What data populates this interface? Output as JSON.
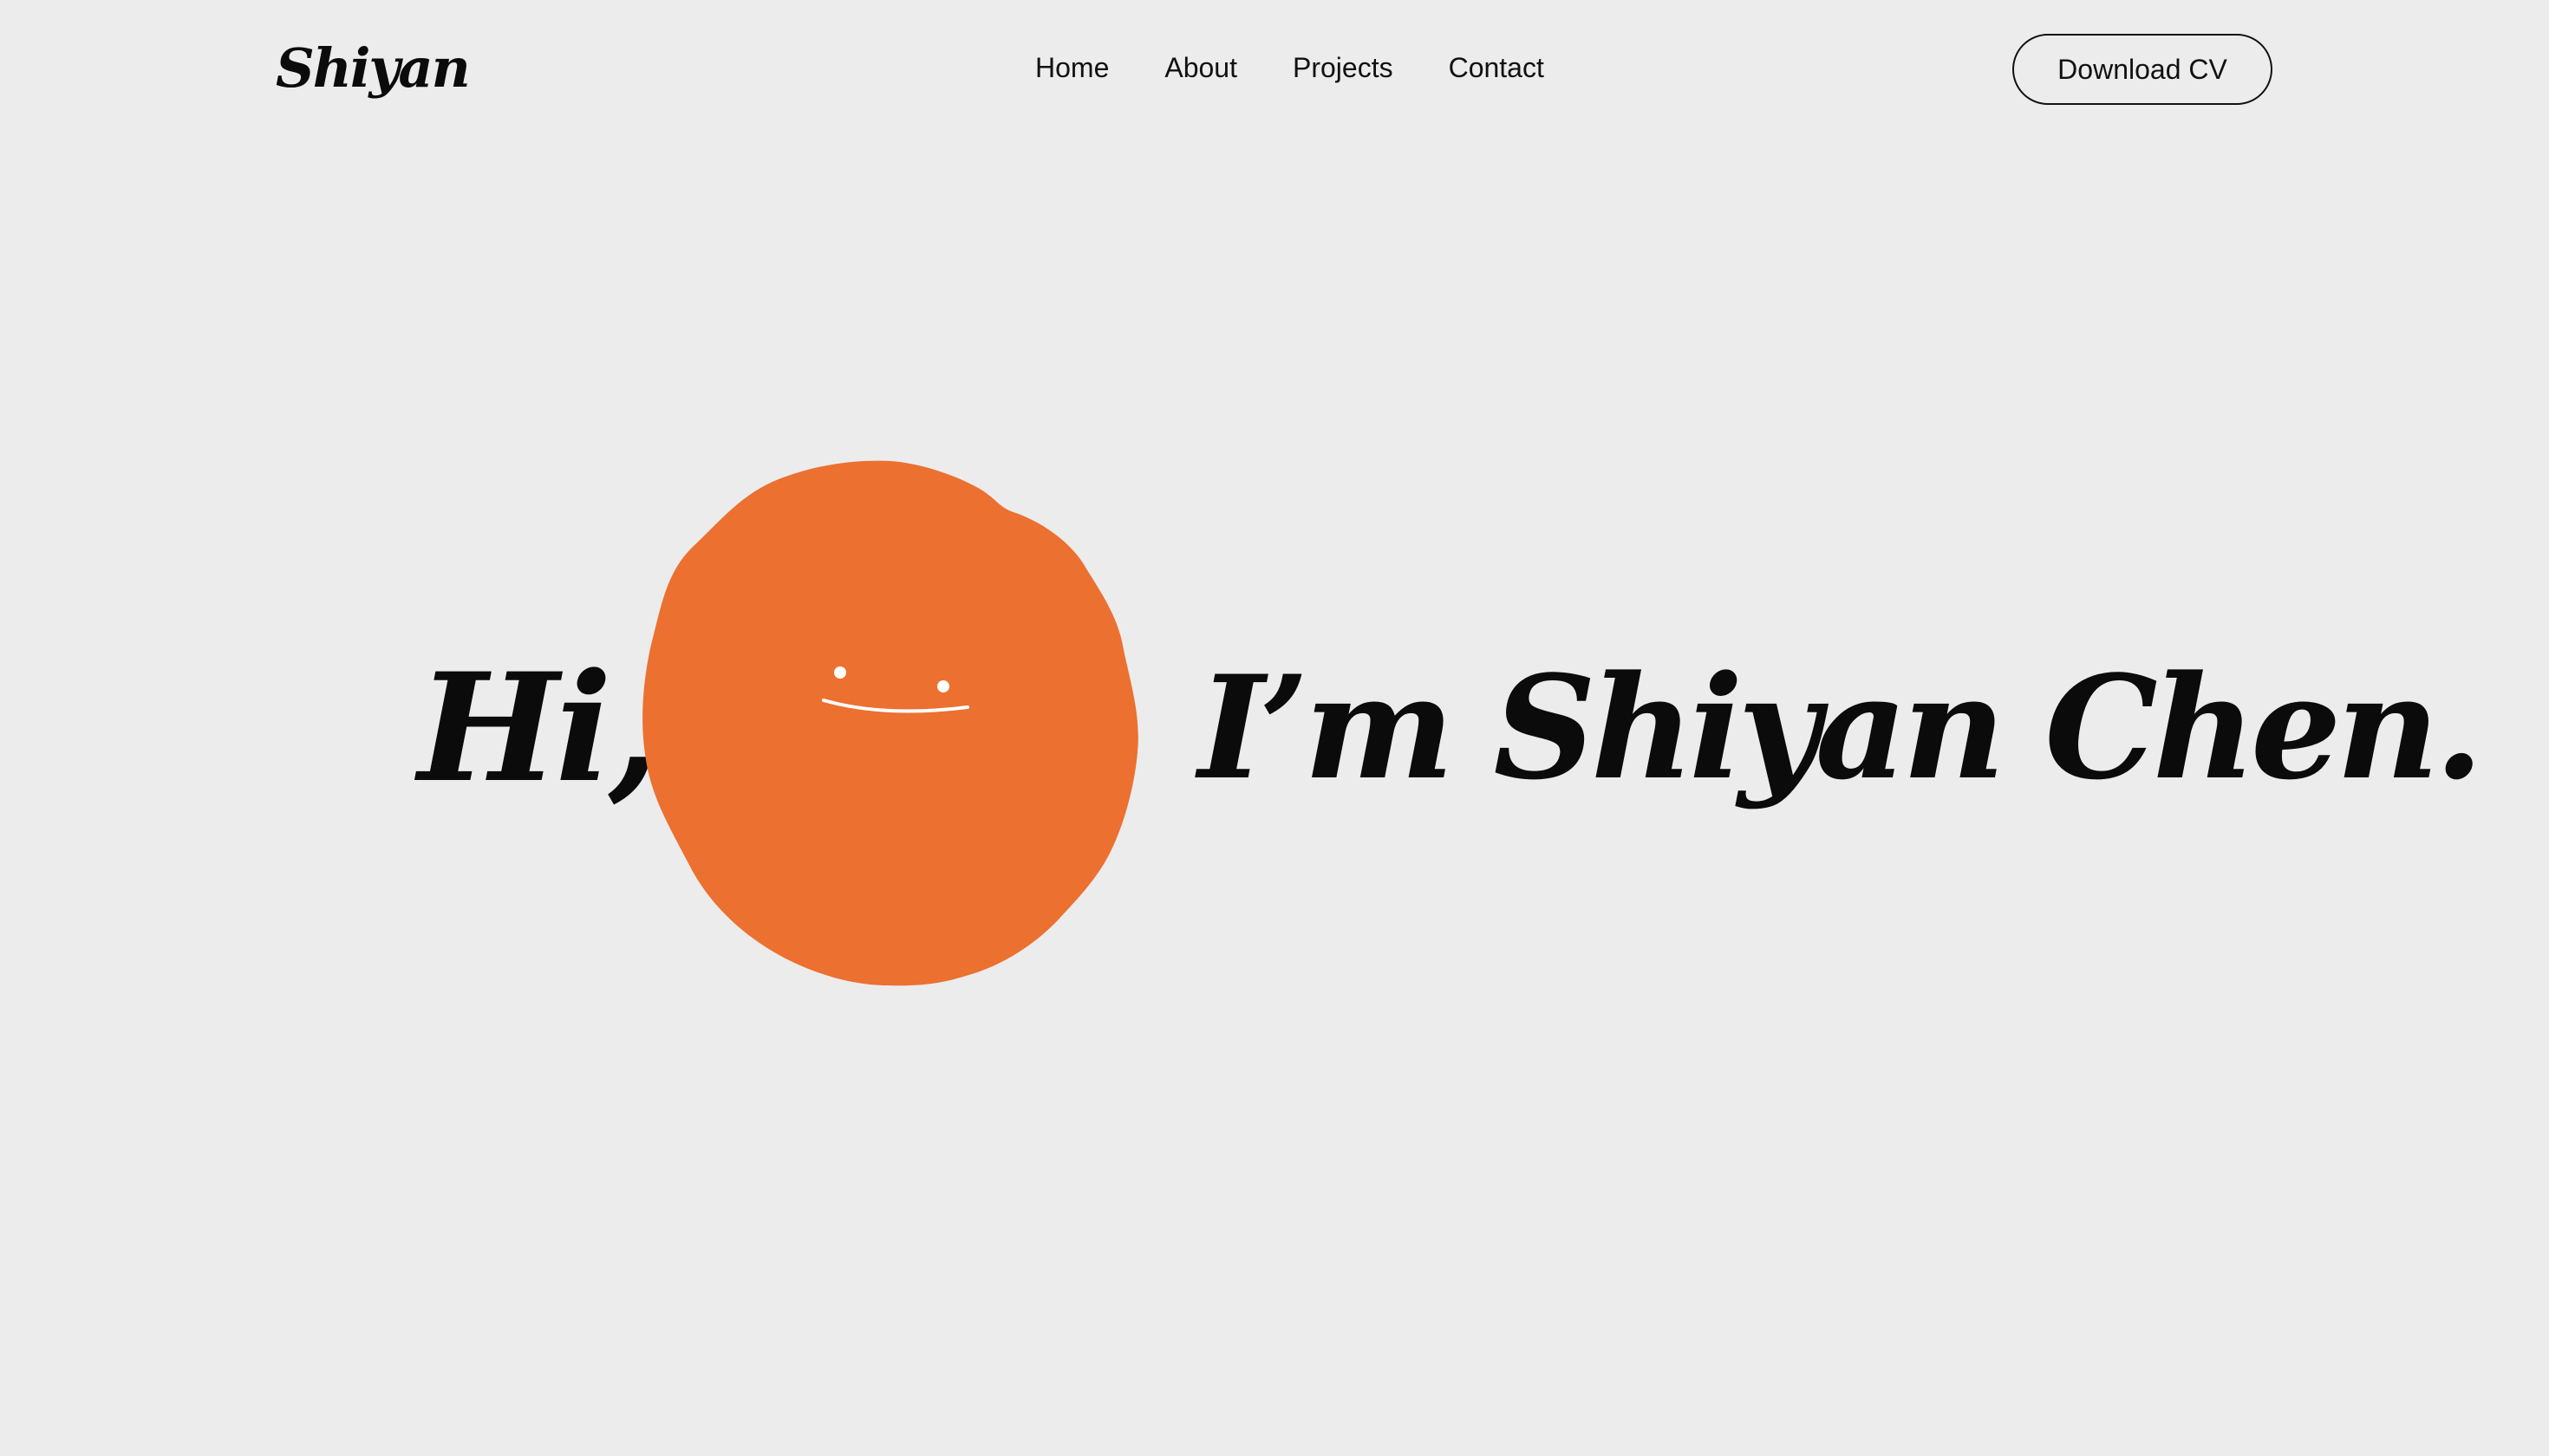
{
  "header": {
    "logo": "Shiyan",
    "nav": [
      {
        "label": "Home"
      },
      {
        "label": "About"
      },
      {
        "label": "Projects"
      },
      {
        "label": "Contact"
      }
    ],
    "cv_button": "Download CV"
  },
  "hero": {
    "greeting": "Hi,",
    "intro": "I’m Shiyan Chen."
  },
  "colors": {
    "background": "#ececec",
    "accent": "#ec7030",
    "text": "#0b0b0b"
  },
  "icons": {
    "mascot": "smiling-orange-blob"
  }
}
